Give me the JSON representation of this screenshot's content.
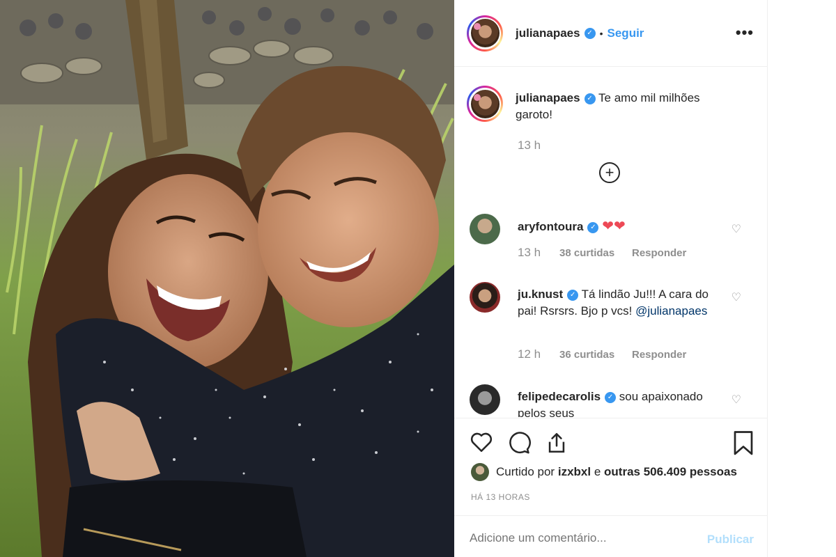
{
  "post": {
    "image_alt": "Selfie of a smiling woman and a boy hugging outdoors",
    "author": {
      "username": "julianapaes",
      "verified": true,
      "follow_label": "Seguir",
      "separator": "•"
    },
    "more_label": "•••",
    "caption": {
      "username": "julianapaes",
      "text": "Te amo mil milhões garoto!",
      "time": "13 h"
    },
    "load_more_icon": "plus-circle-icon"
  },
  "comments": [
    {
      "username": "aryfontoura",
      "verified": true,
      "text": "",
      "emoji": "❤❤",
      "time": "13 h",
      "likes": "38 curtidas",
      "reply": "Responder"
    },
    {
      "username": "ju.knust",
      "verified": true,
      "text": "Tá lindão Ju!!! A cara do pai! Rsrsrs. Bjo p vcs!",
      "mention": "@julianapaes",
      "time": "12 h",
      "likes": "36 curtidas",
      "reply": "Responder"
    },
    {
      "username": "felipedecarolis",
      "verified": true,
      "text": "sou apaixonado pelos seus"
    }
  ],
  "actions": {
    "icons": [
      "heart-icon",
      "comment-icon",
      "share-icon",
      "bookmark-icon"
    ],
    "liked_prefix": "Curtido por",
    "liked_user": "izxbxl",
    "liked_middle": "e",
    "liked_suffix": "outras 506.409 pessoas",
    "ago": "HÁ 13 HORAS"
  },
  "add_comment": {
    "placeholder": "Adicione um comentário...",
    "publish_label": "Publicar"
  },
  "colors": {
    "accent": "#3897f0",
    "text": "#262626",
    "muted": "#8e8e8e",
    "like_red": "#ed4956",
    "publish_disabled": "#b2dffc"
  }
}
